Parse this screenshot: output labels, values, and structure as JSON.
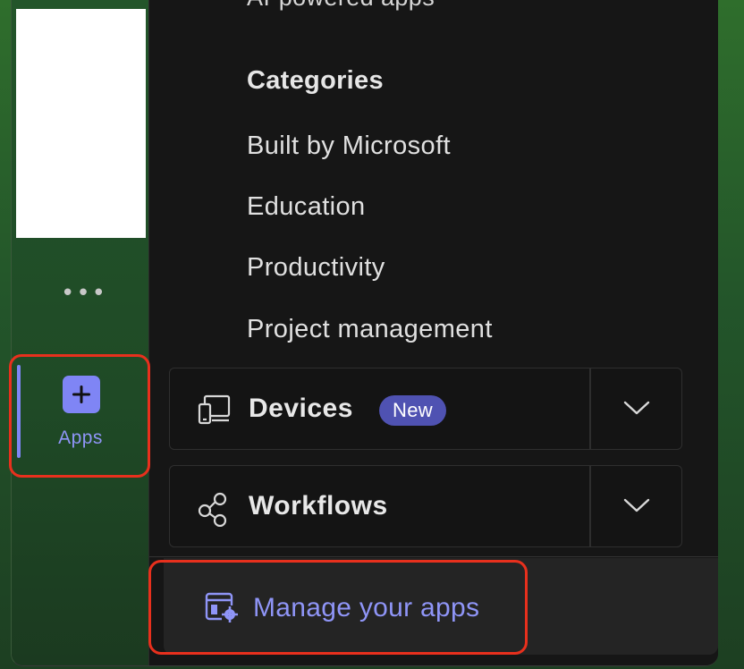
{
  "rail": {
    "more_label": "•••",
    "apps_label": "Apps"
  },
  "panel": {
    "partial_heading": "AI-powered apps",
    "categories_heading": "Categories",
    "categories": [
      "Built by Microsoft",
      "Education",
      "Productivity",
      "Project management"
    ],
    "devices": {
      "label": "Devices",
      "badge": "New"
    },
    "workflows": {
      "label": "Workflows"
    },
    "manage_label": "Manage your apps"
  },
  "colors": {
    "accent": "#7f85f5",
    "badge_bg": "#4f52b2",
    "highlight": "#e8301d",
    "panel_bg": "#161616"
  },
  "icons": {
    "apps": "plus-square-icon",
    "devices": "devices-icon",
    "workflows": "workflows-icon",
    "expand": "chevron-down-icon",
    "manage": "manage-apps-icon"
  }
}
